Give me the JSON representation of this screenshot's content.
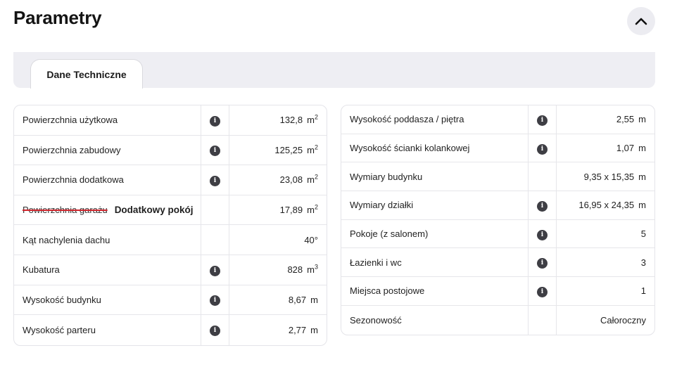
{
  "header": {
    "title": "Parametry"
  },
  "tabs": [
    {
      "label": "Dane Techniczne"
    }
  ],
  "left": [
    {
      "label": "Powierzchnia użytkowa",
      "info": true,
      "value": "132,8",
      "unit": "m",
      "sup": "2"
    },
    {
      "label": "Powierzchnia zabudowy",
      "info": true,
      "value": "125,25",
      "unit": "m",
      "sup": "2"
    },
    {
      "label": "Powierzchnia dodatkowa",
      "info": true,
      "value": "23,08",
      "unit": "m",
      "sup": "2"
    },
    {
      "label": "Powierzchnia garażu",
      "extra": "Dodatkowy pokój",
      "struck": true,
      "info": false,
      "value": "17,89",
      "unit": "m",
      "sup": "2"
    },
    {
      "label": "Kąt nachylenia dachu",
      "info": false,
      "value": "40°",
      "unit": "",
      "sup": ""
    },
    {
      "label": "Kubatura",
      "info": true,
      "value": "828",
      "unit": "m",
      "sup": "3"
    },
    {
      "label": "Wysokość budynku",
      "info": true,
      "value": "8,67",
      "unit": "m",
      "sup": ""
    },
    {
      "label": "Wysokość parteru",
      "info": true,
      "value": "2,77",
      "unit": "m",
      "sup": ""
    }
  ],
  "right": [
    {
      "label": "Wysokość poddasza / piętra",
      "info": true,
      "value": "2,55",
      "unit": "m"
    },
    {
      "label": "Wysokość ścianki kolankowej",
      "info": true,
      "value": "1,07",
      "unit": "m"
    },
    {
      "label": "Wymiary budynku",
      "info": false,
      "value": "9,35 x 15,35",
      "unit": "m"
    },
    {
      "label": "Wymiary działki",
      "info": true,
      "value": "16,95 x 24,35",
      "unit": "m"
    },
    {
      "label": "Pokoje (z salonem)",
      "info": true,
      "value": "5",
      "unit": ""
    },
    {
      "label": "Łazienki i wc",
      "info": true,
      "value": "3",
      "unit": ""
    },
    {
      "label": "Miejsca postojowe",
      "info": true,
      "value": "1",
      "unit": ""
    },
    {
      "label": "Sezonowość",
      "info": false,
      "value": "Całoroczny",
      "unit": ""
    }
  ],
  "icons": {
    "info_glyph": "i",
    "collapse": "chevron-up-icon",
    "info": "info-icon"
  },
  "colors": {
    "strike": "#d0262d",
    "info_bg": "#3e3e44",
    "tabbar_bg": "#eeeef3"
  }
}
